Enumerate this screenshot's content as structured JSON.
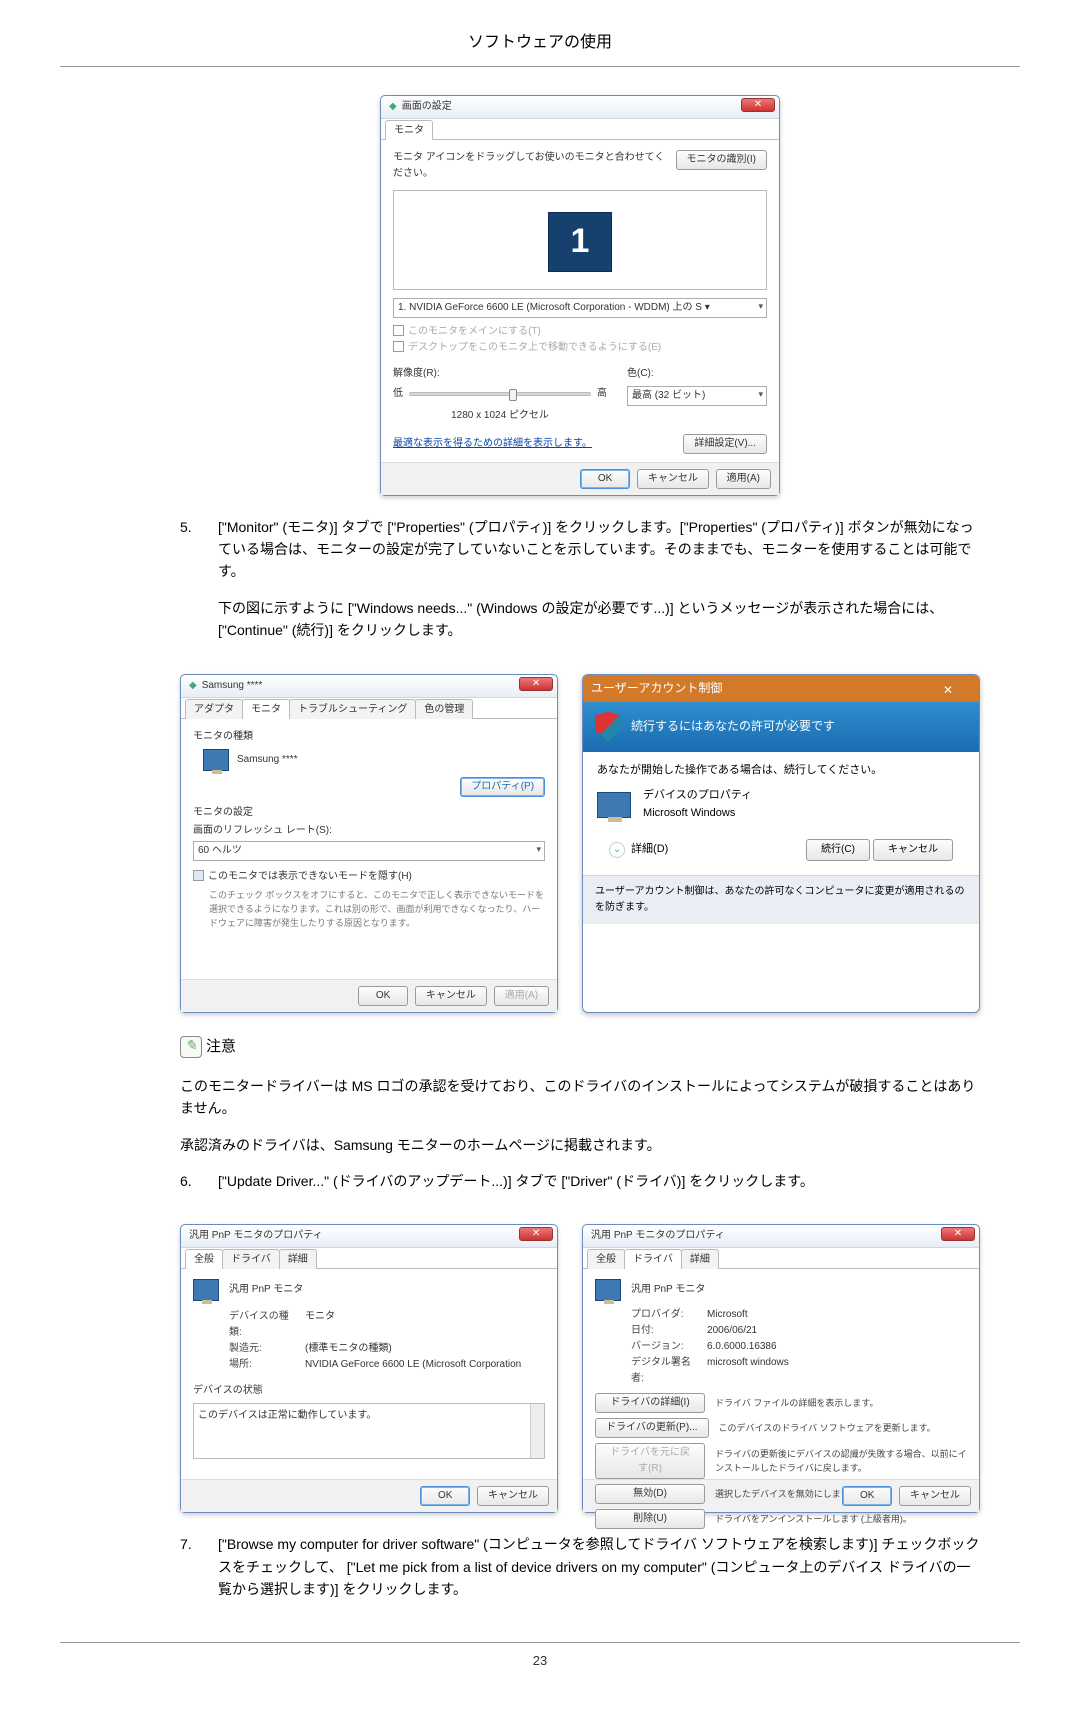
{
  "header": {
    "title": "ソフトウェアの使用"
  },
  "step5": {
    "num": "5.",
    "p1": "[\"Monitor\" (モニタ)] タブで [\"Properties\" (プロパティ)] をクリックします。[\"Properties\" (プロパティ)] ボタンが無効になっている場合は、モニターの設定が完了していないことを示しています。そのままでも、モニターを使用することは可能です。",
    "p2": "下の図に示すように [\"Windows needs...\" (Windows の設定が必要です...)] というメッセージが表示された場合には、[\"Continue\" (続行)] をクリックします。"
  },
  "dlg_display": {
    "title": "画面の設定",
    "tab_monitor": "モニタ",
    "instr": "モニタ アイコンをドラッグしてお使いのモニタと合わせてください。",
    "identify_btn": "モニタの識別(I)",
    "monitor_num": "1",
    "combo_label": "1. NVIDIA GeForce 6600 LE (Microsoft Corporation - WDDM) 上の S ▾",
    "chk1": "このモニタをメインにする(T)",
    "chk2": "デスクトップをこのモニタ上で移動できるようにする(E)",
    "res_label": "解像度(R):",
    "res_low": "低",
    "res_high": "高",
    "res_value": "1280 x 1024 ピクセル",
    "color_label": "色(C):",
    "color_value": "最高 (32 ビット)",
    "advanced_link": "最適な表示を得るための詳細を表示します。",
    "advanced_btn": "詳細設定(V)...",
    "ok": "OK",
    "cancel": "キャンセル",
    "apply": "適用(A)"
  },
  "dlg_adapter": {
    "title": "Samsung ****",
    "tab_adapter": "アダプタ",
    "tab_monitor": "モニタ",
    "tab_trouble": "トラブルシューティング",
    "tab_color": "色の管理",
    "group_kind": "モニタの種類",
    "monitor_name": "Samsung ****",
    "props_btn": "プロパティ(P)",
    "group_set": "モニタの設定",
    "refresh_label": "画面のリフレッシュ レート(S):",
    "refresh_value": "60 ヘルツ",
    "chk_hide": "このモニタでは表示できないモードを隠す(H)",
    "chk_note": "このチェック ボックスをオフにすると、このモニタで正しく表示できないモードを選択できるようになります。これは別の形で、画面が利用できなくなったり、ハードウェアに障害が発生したりする原因となります。",
    "ok": "OK",
    "cancel": "キャンセル",
    "apply": "適用(A)"
  },
  "uac": {
    "title": "ユーザーアカウント制御",
    "head": "続行するにはあなたの許可が必要です",
    "body1": "あなたが開始した操作である場合は、続行してください。",
    "item_title": "デバイスのプロパティ",
    "item_sub": "Microsoft Windows",
    "details": "詳細(D)",
    "cont": "続行(C)",
    "cancel": "キャンセル",
    "foot": "ユーザーアカウント制御は、あなたの許可なくコンピュータに変更が適用されるのを防ぎます。"
  },
  "note": {
    "label": "注意",
    "p1": "このモニタードライバーは MS ロゴの承認を受けており、このドライバのインストールによってシステムが破損することはありません。",
    "p2": "承認済みのドライバは、Samsung モニターのホームページに掲載されます。"
  },
  "step6": {
    "num": "6.",
    "p1": "[\"Update Driver...\" (ドライバのアップデート...)] タブで [\"Driver\" (ドライバ)] をクリックします。"
  },
  "dlg_pnp1": {
    "title": "汎用 PnP モニタのプロパティ",
    "tab_general": "全般",
    "tab_driver": "ドライバ",
    "tab_detail": "詳細",
    "dev_name": "汎用 PnP モニタ",
    "k1": "デバイスの種類:",
    "v1": "モニタ",
    "k2": "製造元:",
    "v2": "(標準モニタの種類)",
    "k3": "場所:",
    "v3": "NVIDIA GeForce 6600 LE (Microsoft Corporation",
    "status_label": "デバイスの状態",
    "status_text": "このデバイスは正常に動作しています。",
    "ok": "OK",
    "cancel": "キャンセル"
  },
  "dlg_pnp2": {
    "title": "汎用 PnP モニタのプロパティ",
    "tab_general": "全般",
    "tab_driver": "ドライバ",
    "tab_detail": "詳細",
    "dev_name": "汎用 PnP モニタ",
    "k1": "プロバイダ:",
    "v1": "Microsoft",
    "k2": "日付:",
    "v2": "2006/06/21",
    "k3": "バージョン:",
    "v3": "6.0.6000.16386",
    "k4": "デジタル署名者:",
    "v4": "microsoft windows",
    "b1": "ドライバの詳細(I)",
    "d1": "ドライバ ファイルの詳細を表示します。",
    "b2": "ドライバの更新(P)...",
    "d2": "このデバイスのドライバ ソフトウェアを更新します。",
    "b3": "ドライバを元に戻す(R)",
    "d3": "ドライバの更新後にデバイスの認識が失敗する場合、以前にインストールしたドライバに戻します。",
    "b4": "無効(D)",
    "d4": "選択したデバイスを無効にします。",
    "b5": "削除(U)",
    "d5": "ドライバをアンインストールします (上級者用)。",
    "ok": "OK",
    "cancel": "キャンセル"
  },
  "step7": {
    "num": "7.",
    "p1": "[\"Browse my computer for driver software\" (コンピュータを参照してドライバ ソフトウェアを検索します)] チェックボックスをチェックして、 [\"Let me pick from a list of device drivers on my computer\" (コンピュータ上のデバイス ドライバの一覧から選択します)] をクリックします。"
  },
  "page_number": "23"
}
